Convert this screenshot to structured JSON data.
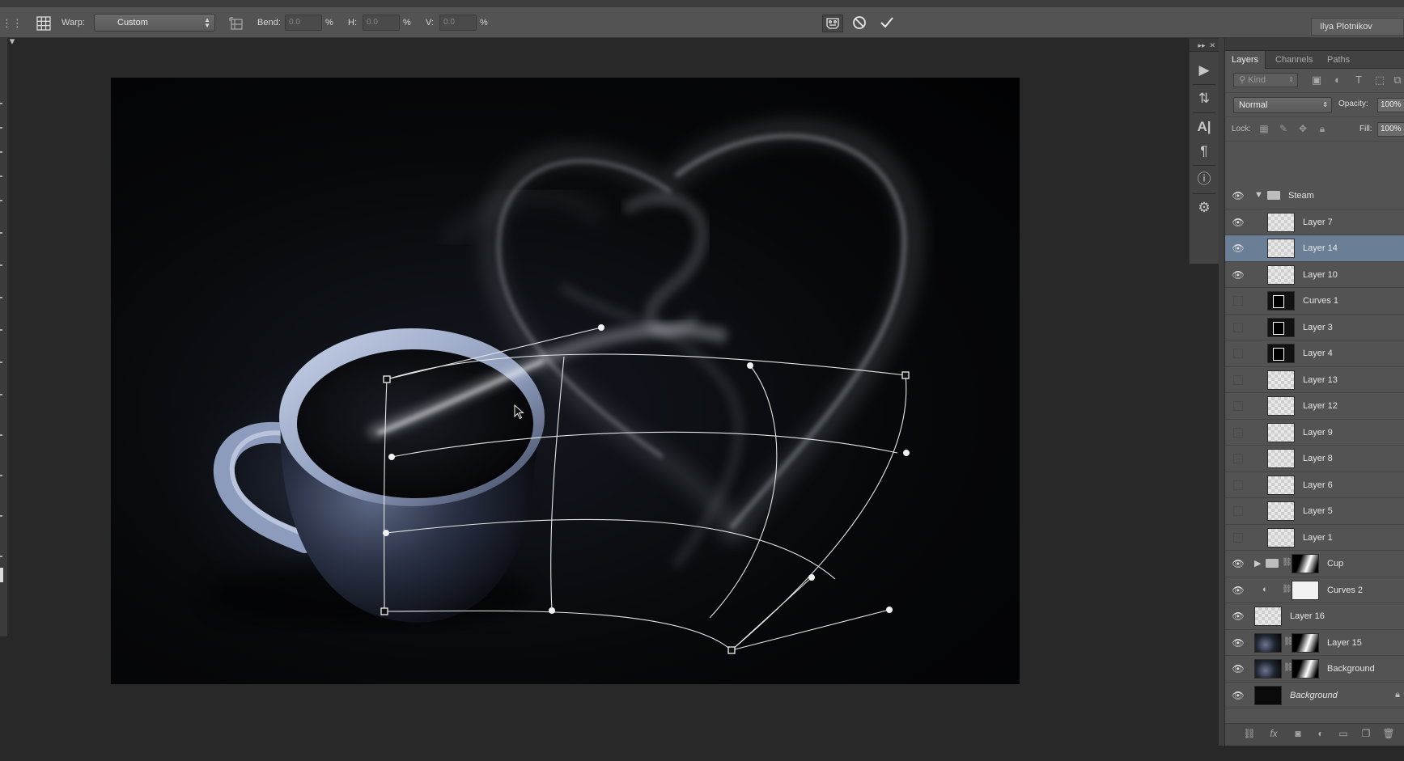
{
  "options_bar": {
    "warp_label": "Warp:",
    "warp_value": "Custom",
    "bend_label": "Bend:",
    "bend_value": "0.0",
    "h_label": "H:",
    "h_value": "0.0",
    "v_label": "V:",
    "v_value": "0.0",
    "percent": "%",
    "user_name": "Ilya Plotnikov"
  },
  "icons": {
    "warp_grid": "grid-icon",
    "change_warp_orientation": "warp-orientation-icon",
    "puppet": "puppet-warp-icon",
    "cancel": "cancel-icon",
    "commit": "checkmark-icon"
  },
  "layers_panel": {
    "tabs": [
      "Layers",
      "Channels",
      "Paths"
    ],
    "kind_label": "Kind",
    "blend_mode": "Normal",
    "opacity_label": "Opacity:",
    "opacity_value": "100%",
    "lock_label": "Lock:",
    "fill_label": "Fill:",
    "fill_value": "100%",
    "layers": [
      {
        "name": "Steam",
        "type": "group",
        "visible": true,
        "expanded": true
      },
      {
        "name": "Layer 7",
        "type": "layer",
        "visible": true,
        "indent": true
      },
      {
        "name": "Layer 14",
        "type": "layer",
        "visible": true,
        "indent": true,
        "selected": true
      },
      {
        "name": "Layer 10",
        "type": "layer",
        "visible": true,
        "indent": true
      },
      {
        "name": "Curves 1",
        "type": "curves",
        "visible": false,
        "indent": true
      },
      {
        "name": "Layer 3",
        "type": "layer-shape",
        "visible": false,
        "indent": true
      },
      {
        "name": "Layer 4",
        "type": "layer-shape2",
        "visible": false,
        "indent": true
      },
      {
        "name": "Layer 13",
        "type": "layer",
        "visible": false,
        "indent": true
      },
      {
        "name": "Layer 12",
        "type": "layer",
        "visible": false,
        "indent": true
      },
      {
        "name": "Layer 9",
        "type": "layer",
        "visible": false,
        "indent": true
      },
      {
        "name": "Layer 8",
        "type": "layer",
        "visible": false,
        "indent": true
      },
      {
        "name": "Layer 6",
        "type": "layer",
        "visible": false,
        "indent": true
      },
      {
        "name": "Layer 5",
        "type": "layer",
        "visible": false,
        "indent": true
      },
      {
        "name": "Layer 1",
        "type": "layer",
        "visible": false,
        "indent": true
      },
      {
        "name": "Cup",
        "type": "group-mask",
        "visible": true
      },
      {
        "name": "Curves 2",
        "type": "adjust-mask",
        "visible": true
      },
      {
        "name": "Layer 16",
        "type": "layer",
        "visible": true
      },
      {
        "name": "Layer 15",
        "type": "photo-mask",
        "visible": true
      },
      {
        "name": "Background",
        "type": "photo-mask",
        "visible": true
      },
      {
        "name": "Background",
        "type": "background",
        "visible": true,
        "italic": true,
        "locked": true
      }
    ]
  }
}
